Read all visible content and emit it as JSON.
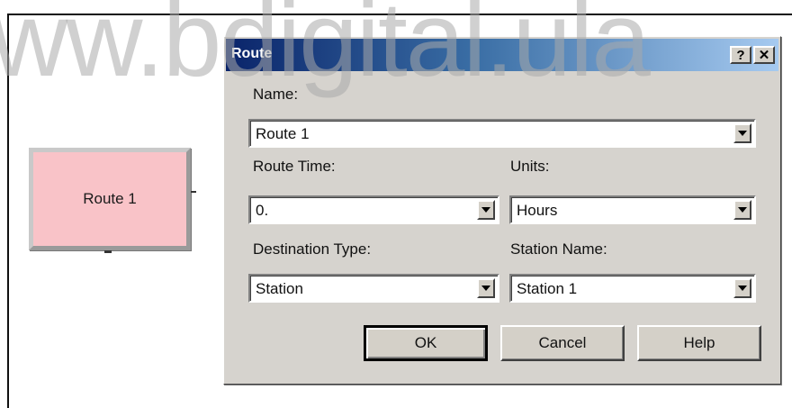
{
  "watermark": "ww.bdigital.ula",
  "module": {
    "label": "Route 1"
  },
  "dialog": {
    "title": "Route",
    "help_glyph": "?",
    "close_glyph": "✕",
    "name": {
      "label": "Name:",
      "value": "Route 1"
    },
    "route_time": {
      "label": "Route Time:",
      "value": "0."
    },
    "units": {
      "label": "Units:",
      "value": "Hours"
    },
    "destination_type": {
      "label": "Destination Type:",
      "value": "Station"
    },
    "station_name": {
      "label": "Station Name:",
      "value": "Station 1"
    },
    "buttons": {
      "ok": "OK",
      "cancel": "Cancel",
      "help": "Help"
    }
  },
  "colors": {
    "module_fill": "#f9c3c8",
    "title_gradient_start": "#0a246a",
    "dialog_face": "#d6d3ce"
  }
}
